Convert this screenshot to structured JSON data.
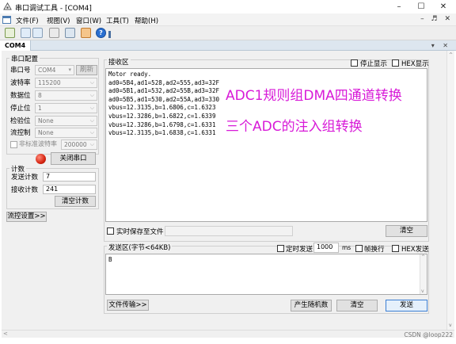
{
  "window": {
    "title": "串口调试工具 - [COM4]",
    "controls": {
      "minimize": "–",
      "maximize": "☐",
      "close": "✕"
    }
  },
  "menu": {
    "items": [
      "文件(F)",
      "视图(V)",
      "窗口(W)",
      "工具(T)",
      "帮助(H)"
    ],
    "mdi_controls": "– ♬ ✕"
  },
  "tab": {
    "label": "COM4",
    "controls": "▾ ✕"
  },
  "port_config": {
    "title": "串口配置",
    "port_label": "串口号",
    "port_value": "COM4",
    "refresh_label": "刷新",
    "baud_label": "波特率",
    "baud_value": "115200",
    "databits_label": "数据位",
    "databits_value": "8",
    "stopbits_label": "停止位",
    "stopbits_value": "1",
    "parity_label": "检验位",
    "parity_value": "None",
    "flow_label": "流控制",
    "flow_value": "None",
    "nonstd_label": "非标准波特率",
    "nonstd_value": "200000",
    "open_close_label": "关闭串口"
  },
  "counter": {
    "title": "计数",
    "sent_label": "发送计数",
    "sent_value": "7",
    "recv_label": "接收计数",
    "recv_value": "241",
    "clear_label": "清空计数"
  },
  "flow_settings_label": "流控设置>>",
  "receive": {
    "title": "接收区",
    "stop_display_label": "停止显示",
    "hex_display_label": "HEX显示",
    "lines": [
      "Motor ready.",
      "ad0=5B4,ad1=528,ad2=555,ad3=32F",
      "ad0=5B1,ad1=532,ad2=55B,ad3=32F",
      "ad0=5B5,ad1=530,ad2=55A,ad3=330",
      "vbus=12.3135,b=1.6806,c=1.6323",
      "vbus=12.3286,b=1.6822,c=1.6339",
      "vbus=12.3286,b=1.6798,c=1.6331",
      "vbus=12.3135,b=1.6838,c=1.6331"
    ],
    "annotation_1": "ADC1规则组DMA四通道转换",
    "annotation_2": "三个ADC的注入组转换",
    "save_realtime_label": "实时保存至文件",
    "clear_label": "清空"
  },
  "send": {
    "title": "发送区(字节<64KB)",
    "timed_send_label": "定时发送",
    "interval_value": "1000",
    "interval_unit": "ms",
    "newline_label": "帧换行",
    "hex_send_label": "HEX发送",
    "content": "B",
    "file_transfer_label": "文件传输>>",
    "random_label": "产生随机数",
    "clear_label": "清空",
    "send_label": "发送"
  },
  "watermark": "CSDN @loop222"
}
